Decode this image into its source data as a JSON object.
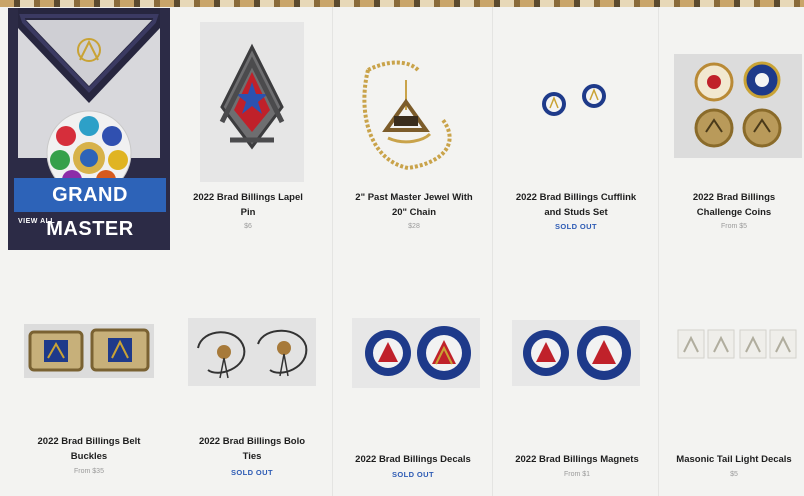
{
  "promo": {
    "title": "GRAND MASTER",
    "link_label": "VIEW ALL"
  },
  "colors": {
    "accent_blue": "#2d63b8",
    "sold_out": "#2d5bb4",
    "price_gray": "#9a9a9a"
  },
  "products": [
    {
      "name_line1": "2022 Brad Billings Lapel",
      "name_line2": "Pin",
      "price": "$6",
      "price_type": "price"
    },
    {
      "name_line1": "2\" Past Master Jewel With",
      "name_line2": "20\" Chain",
      "price": "$28",
      "price_type": "price"
    },
    {
      "name_line1": "2022 Brad Billings Cufflink",
      "name_line2": "and Studs Set",
      "price": "SOLD OUT",
      "price_type": "sold-out"
    },
    {
      "name_line1": "2022 Brad Billings",
      "name_line2": "Challenge Coins",
      "price": "From $5",
      "price_type": "price"
    },
    {
      "name_line1": "2022 Brad Billings Belt",
      "name_line2": "Buckles",
      "price": "From $35",
      "price_type": "price"
    },
    {
      "name_line1": "2022 Brad Billings Bolo",
      "name_line2": "Ties",
      "price": "SOLD OUT",
      "price_type": "sold-out"
    },
    {
      "name_line1": "2022 Brad Billings Decals",
      "name_line2": "",
      "price": "SOLD OUT",
      "price_type": "sold-out"
    },
    {
      "name_line1": "2022 Brad Billings Magnets",
      "name_line2": "",
      "price": "From $1",
      "price_type": "price"
    },
    {
      "name_line1": "Masonic Tail Light Decals",
      "name_line2": "",
      "price": "$5",
      "price_type": "price"
    }
  ]
}
